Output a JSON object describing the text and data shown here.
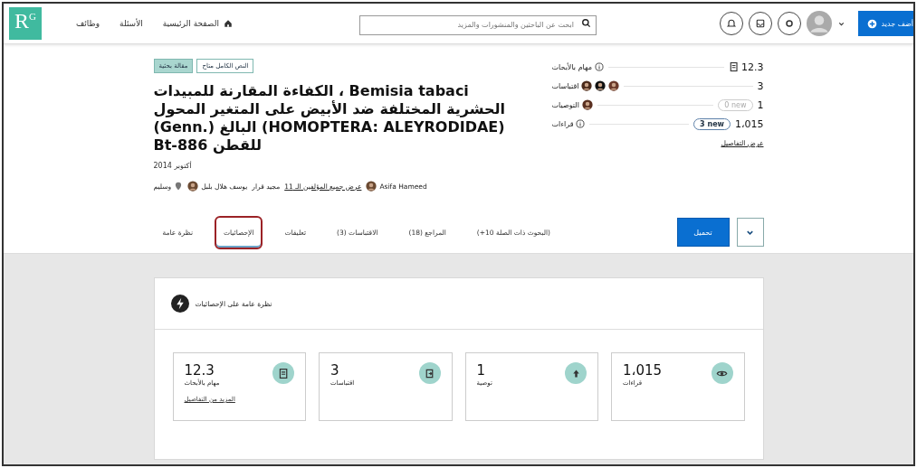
{
  "header": {
    "logo": "R",
    "logo_sup": "G",
    "nav": [
      {
        "label": "الصفحة الرئيسية"
      },
      {
        "label": "الأسئلة"
      },
      {
        "label": "وظائف"
      }
    ],
    "search": {
      "placeholder": "ابحث عن الباحثين والمنشورات والمزيد"
    },
    "add_button": "أضف جديد"
  },
  "publication": {
    "badges": [
      {
        "label": "النص الكامل متاح",
        "kind": "outline"
      },
      {
        "label": "مقالة بحثية",
        "kind": "filled"
      }
    ],
    "title": "Bemisia tabaci ، الكفاءة المقارنة للمبيدات الحشرية المختلفة ضد الأبيض على المتغير المحول (HOMOPTERA: ALEYRODIDAE) البالغ (.Genn) للقطن Bt-886",
    "date": "أكتوبر 2014",
    "authors": [
      {
        "name": "Asifa Hameed",
        "kind": "person"
      },
      {
        "name": "عرض جميع المؤلفين الـ 11",
        "kind": "link"
      },
      {
        "name": "مجيد قرار",
        "kind": "plain"
      },
      {
        "name": "يوسف هلال بلبل",
        "kind": "person"
      },
      {
        "name": "وسليم",
        "kind": "pin"
      }
    ]
  },
  "metrics": [
    {
      "label": "مهام بالأبحاث",
      "value": "12.3",
      "kind": "score",
      "info": true
    },
    {
      "label": "اقتباسات",
      "value": "3",
      "kind": "citations",
      "info": false
    },
    {
      "label": "التوصيات",
      "value": "1",
      "kind": "recommendations",
      "info": false,
      "new_badge": {
        "text": "0 new",
        "highlighted": false
      }
    },
    {
      "label": "قراءات",
      "value": "1،015",
      "kind": "reads",
      "info": true,
      "new_badge": {
        "text": "3 new",
        "highlighted": true
      }
    }
  ],
  "metrics_link": "عرض التفاصيل",
  "tabs": [
    {
      "label": "(+10 البحوث ذات الصلة)",
      "selected": false
    },
    {
      "label": "المراجع (18)",
      "selected": false
    },
    {
      "label": "الاقتباسات (3)",
      "selected": false
    },
    {
      "label": "تعليقات",
      "selected": false
    },
    {
      "label": "الإحصائيات",
      "selected": true
    },
    {
      "label": "نظرة عامة",
      "selected": false
    }
  ],
  "download_button": "تحميل",
  "stats": {
    "title": "نظرة عامة على الإحصائيات",
    "cards": [
      {
        "value": "1،015",
        "label": "قراءات",
        "kind": "reads"
      },
      {
        "value": "1",
        "label": "توصية",
        "kind": "recommendations"
      },
      {
        "value": "3",
        "label": "اقتباسات",
        "kind": "citations"
      },
      {
        "value": "12.3",
        "label": "مهام بالأبحاث",
        "kind": "score",
        "link": "المزيد من التفاصيل"
      }
    ]
  }
}
